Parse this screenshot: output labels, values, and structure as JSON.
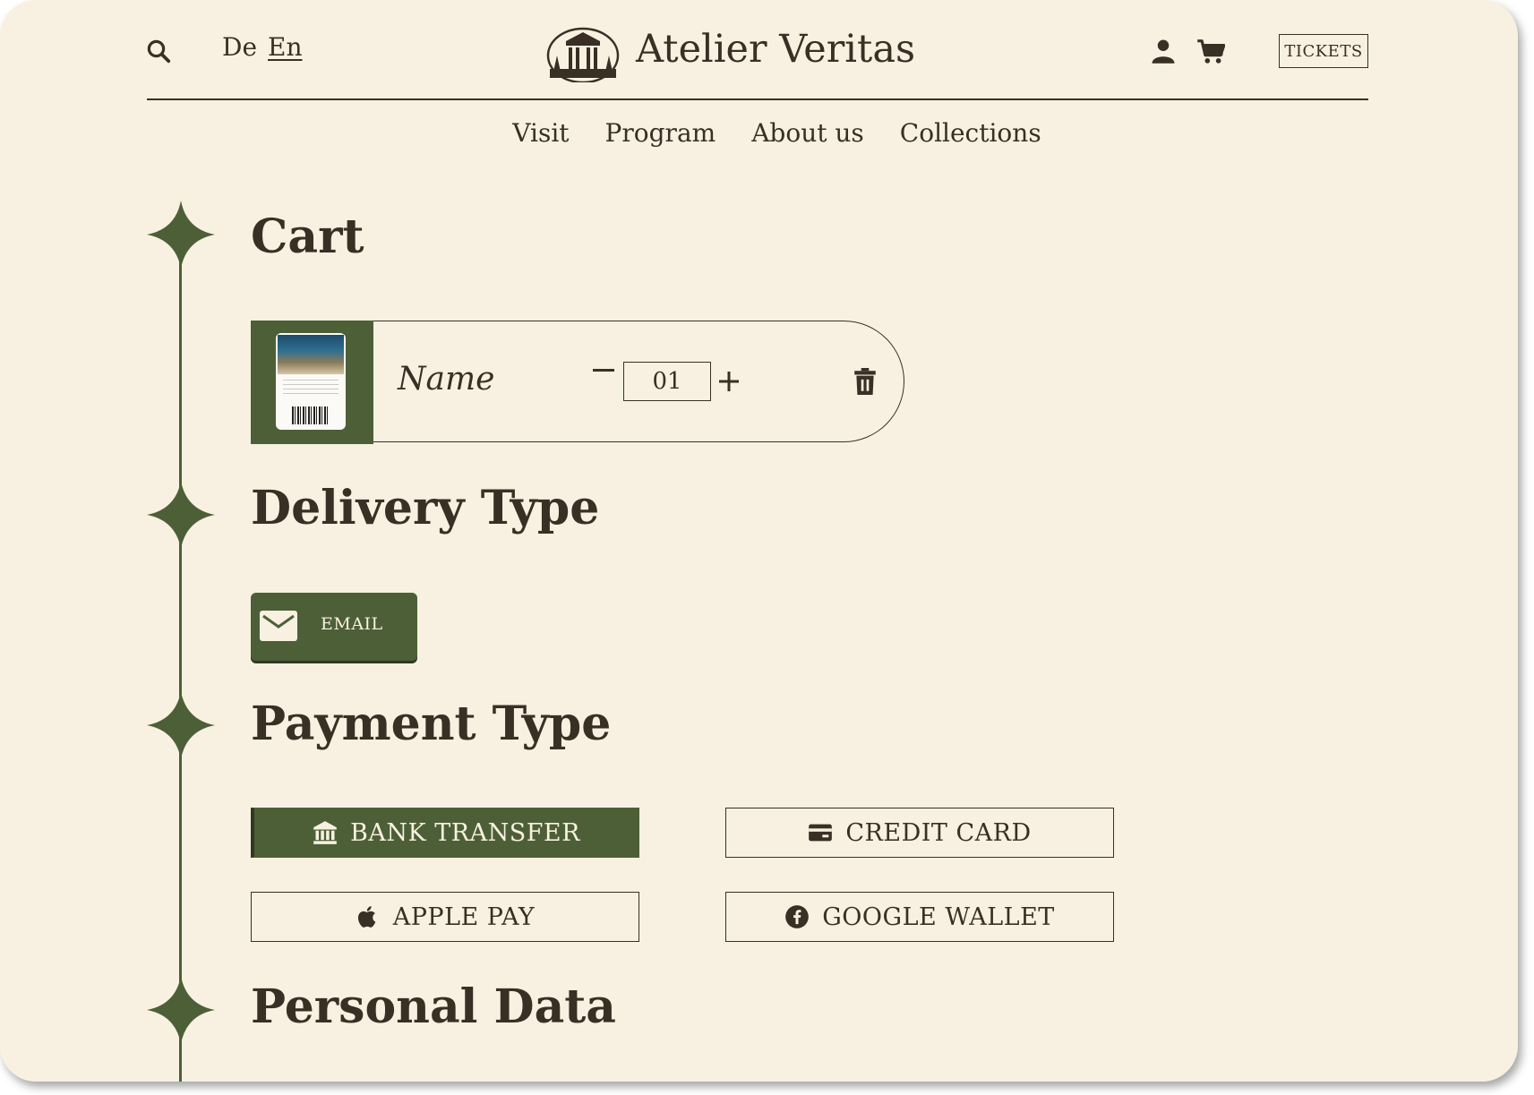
{
  "brand": {
    "name": "Atelier Veritas"
  },
  "languages": [
    {
      "label": "De",
      "active": false
    },
    {
      "label": "En",
      "active": true
    }
  ],
  "header": {
    "tickets_label": "TICKETS"
  },
  "nav": [
    "Visit",
    "Program",
    "About us",
    "Collections"
  ],
  "sections": {
    "cart": "Cart",
    "delivery": "Delivery Type",
    "payment": "Payment Type",
    "personal": "Personal Data"
  },
  "cart": {
    "item_name": "Name",
    "quantity": "01"
  },
  "delivery": {
    "options": [
      {
        "label": "EMAIL",
        "icon": "mail-icon",
        "selected": true
      }
    ]
  },
  "payment": {
    "options": [
      {
        "label": "BANK TRANSFER",
        "icon": "bank-icon",
        "selected": true
      },
      {
        "label": "CREDIT CARD",
        "icon": "credit-card-icon",
        "selected": false
      },
      {
        "label": "APPLE PAY",
        "icon": "apple-icon",
        "selected": false
      },
      {
        "label": "GOOGLE WALLET",
        "icon": "google-wallet-icon",
        "selected": false
      }
    ]
  },
  "colors": {
    "background": "#f8f1e1",
    "accent": "#4d5f37",
    "text": "#3a2f25"
  }
}
